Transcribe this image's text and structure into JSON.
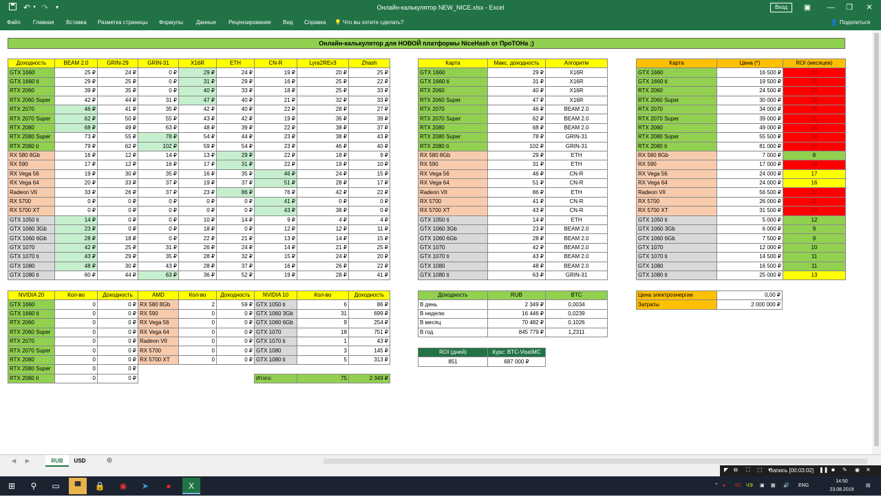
{
  "window": {
    "title": "Онлайн-калькулятор NEW_NICE.xlsx  -  Excel",
    "signin": "Вход"
  },
  "ribbon": {
    "tabs": [
      "Файл",
      "Главная",
      "Вставка",
      "Разметка страницы",
      "Формулы",
      "Данные",
      "Рецензирование",
      "Вид",
      "Справка"
    ],
    "tell_me": "Что вы хотите сделать?",
    "share": "Поделиться"
  },
  "banner": "Онлайн-калькулятор для НОВОЙ платформы NiceHash от ПроТОНа ;)",
  "t1": {
    "headers": [
      "Доходность",
      "BEAM 2.0",
      "GRIN-29",
      "GRIN-31",
      "X16R",
      "ETH",
      "CN-R",
      "Lyra2REv3",
      "Zhash"
    ],
    "rows": [
      [
        "GTX 1660",
        "25 ₽",
        "24 ₽",
        "0 ₽",
        "29 ₽",
        "24 ₽",
        "19 ₽",
        "20 ₽",
        "25 ₽"
      ],
      [
        "GTX 1660 ti",
        "29 ₽",
        "25 ₽",
        "0 ₽",
        "31 ₽",
        "29 ₽",
        "16 ₽",
        "25 ₽",
        "22 ₽"
      ],
      [
        "RTX 2060",
        "39 ₽",
        "35 ₽",
        "0 ₽",
        "40 ₽",
        "33 ₽",
        "18 ₽",
        "25 ₽",
        "33 ₽"
      ],
      [
        "RTX 2060 Super",
        "42 ₽",
        "44 ₽",
        "31 ₽",
        "47 ₽",
        "40 ₽",
        "21 ₽",
        "32 ₽",
        "33 ₽"
      ],
      [
        "RTX 2070",
        "46 ₽",
        "41 ₽",
        "35 ₽",
        "42 ₽",
        "40 ₽",
        "22 ₽",
        "28 ₽",
        "27 ₽"
      ],
      [
        "RTX 2070 Super",
        "62 ₽",
        "50 ₽",
        "55 ₽",
        "43 ₽",
        "42 ₽",
        "19 ₽",
        "36 ₽",
        "39 ₽"
      ],
      [
        "RTX 2080",
        "68 ₽",
        "49 ₽",
        "63 ₽",
        "48 ₽",
        "39 ₽",
        "22 ₽",
        "38 ₽",
        "37 ₽"
      ],
      [
        "RTX 2080 Super",
        "73 ₽",
        "55 ₽",
        "78 ₽",
        "54 ₽",
        "44 ₽",
        "23 ₽",
        "38 ₽",
        "43 ₽"
      ],
      [
        "RTX 2080 ti",
        "79 ₽",
        "62 ₽",
        "102 ₽",
        "59 ₽",
        "54 ₽",
        "23 ₽",
        "46 ₽",
        "40 ₽"
      ],
      [
        "RX 580 8Gb",
        "16 ₽",
        "12 ₽",
        "14 ₽",
        "13 ₽",
        "29 ₽",
        "22 ₽",
        "18 ₽",
        "9 ₽"
      ],
      [
        "RX 590",
        "17 ₽",
        "12 ₽",
        "16 ₽",
        "17 ₽",
        "31 ₽",
        "22 ₽",
        "19 ₽",
        "10 ₽"
      ],
      [
        "RX Vega 56",
        "19 ₽",
        "30 ₽",
        "35 ₽",
        "16 ₽",
        "35 ₽",
        "46 ₽",
        "24 ₽",
        "15 ₽"
      ],
      [
        "RX Vega 64",
        "20 ₽",
        "33 ₽",
        "37 ₽",
        "19 ₽",
        "37 ₽",
        "51 ₽",
        "28 ₽",
        "17 ₽"
      ],
      [
        "Radeon VII",
        "33 ₽",
        "26 ₽",
        "37 ₽",
        "23 ₽",
        "86 ₽",
        "76 ₽",
        "42 ₽",
        "22 ₽"
      ],
      [
        "RX 5700",
        "0 ₽",
        "0 ₽",
        "0 ₽",
        "0 ₽",
        "0 ₽",
        "41 ₽",
        "0 ₽",
        "0 ₽"
      ],
      [
        "RX 5700 XT",
        "0 ₽",
        "0 ₽",
        "0 ₽",
        "0 ₽",
        "0 ₽",
        "43 ₽",
        "38 ₽",
        "0 ₽"
      ],
      [
        "GTX 1050 ti",
        "14 ₽",
        "0 ₽",
        "0 ₽",
        "10 ₽",
        "14 ₽",
        "9 ₽",
        "4 ₽",
        "4 ₽"
      ],
      [
        "GTX 1060 3Gb",
        "23 ₽",
        "0 ₽",
        "0 ₽",
        "18 ₽",
        "0 ₽",
        "12 ₽",
        "12 ₽",
        "11 ₽"
      ],
      [
        "GTX 1060 6Gb",
        "28 ₽",
        "18 ₽",
        "0 ₽",
        "22 ₽",
        "21 ₽",
        "13 ₽",
        "14 ₽",
        "15 ₽"
      ],
      [
        "GTX 1070",
        "42 ₽",
        "25 ₽",
        "31 ₽",
        "26 ₽",
        "24 ₽",
        "14 ₽",
        "21 ₽",
        "25 ₽"
      ],
      [
        "GTX 1070 ti",
        "43 ₽",
        "29 ₽",
        "35 ₽",
        "28 ₽",
        "32 ₽",
        "15 ₽",
        "24 ₽",
        "20 ₽"
      ],
      [
        "GTX 1080",
        "48 ₽",
        "30 ₽",
        "43 ₽",
        "28 ₽",
        "37 ₽",
        "16 ₽",
        "26 ₽",
        "22 ₽"
      ],
      [
        "GTX 1080 ti",
        "60 ₽",
        "44 ₽",
        "63 ₽",
        "36 ₽",
        "52 ₽",
        "19 ₽",
        "28 ₽",
        "41 ₽"
      ]
    ]
  },
  "t2": {
    "headers": [
      "Карта",
      "Макс. доходность",
      "Алгоритм"
    ],
    "rows": [
      [
        "GTX 1660",
        "29 ₽",
        "X16R"
      ],
      [
        "GTX 1660 ti",
        "31 ₽",
        "X16R"
      ],
      [
        "RTX 2060",
        "40 ₽",
        "X16R"
      ],
      [
        "RTX 2060 Super",
        "47 ₽",
        "X16R"
      ],
      [
        "RTX 2070",
        "46 ₽",
        "BEAM 2.0"
      ],
      [
        "RTX 2070 Super",
        "62 ₽",
        "BEAM 2.0"
      ],
      [
        "RTX 2080",
        "68 ₽",
        "BEAM 2.0"
      ],
      [
        "RTX 2080 Super",
        "78 ₽",
        "GRIN-31"
      ],
      [
        "RTX 2080 ti",
        "102 ₽",
        "GRIN-31"
      ],
      [
        "RX 580 8Gb",
        "29 ₽",
        "ETH"
      ],
      [
        "RX 590",
        "31 ₽",
        "ETH"
      ],
      [
        "RX Vega 56",
        "46 ₽",
        "CN-R"
      ],
      [
        "RX Vega 64",
        "51 ₽",
        "CN-R"
      ],
      [
        "Radeon VII",
        "86 ₽",
        "ETH"
      ],
      [
        "RX 5700",
        "41 ₽",
        "CN-R"
      ],
      [
        "RX 5700 XT",
        "43 ₽",
        "CN-R"
      ],
      [
        "GTX 1050 ti",
        "14 ₽",
        "ETH"
      ],
      [
        "GTX 1060 3Gb",
        "23 ₽",
        "BEAM 2.0"
      ],
      [
        "GTX 1060 6Gb",
        "28 ₽",
        "BEAM 2.0"
      ],
      [
        "GTX 1070",
        "42 ₽",
        "BEAM 2.0"
      ],
      [
        "GTX 1070 ti",
        "43 ₽",
        "BEAM 2.0"
      ],
      [
        "GTX 1080",
        "48 ₽",
        "BEAM 2.0"
      ],
      [
        "GTX 1080 ti",
        "63 ₽",
        "GRIN-31"
      ]
    ]
  },
  "t3": {
    "headers": [
      "Карта",
      "Цена (*)",
      "ROI (месяцев)"
    ],
    "rows": [
      [
        "GTX 1660",
        "16 500 ₽",
        "19"
      ],
      [
        "GTX 1660 ti",
        "19 500 ₽",
        "21"
      ],
      [
        "RTX 2060",
        "24 500 ₽",
        "20"
      ],
      [
        "RTX 2060 Super",
        "30 000 ₽",
        "21"
      ],
      [
        "RTX 2070",
        "34 000 ₽",
        "25"
      ],
      [
        "RTX 2070 Super",
        "39 000 ₽",
        "21"
      ],
      [
        "RTX 2080",
        "49 000 ₽",
        "24"
      ],
      [
        "RTX 2080 Super",
        "55 500 ₽",
        "24"
      ],
      [
        "RTX 2080 ti",
        "81 000 ₽",
        "27"
      ],
      [
        "RX 580 8Gb",
        "7 000 ₽",
        "8"
      ],
      [
        "RX 590",
        "17 000 ₽",
        "18"
      ],
      [
        "RX Vega 56",
        "24 000 ₽",
        "17"
      ],
      [
        "RX Vega 64",
        "24 000 ₽",
        "16"
      ],
      [
        "Radeon VII",
        "56 500 ₽",
        "22"
      ],
      [
        "RX 5700",
        "26 000 ₽",
        "21"
      ],
      [
        "RX 5700 XT",
        "31 500 ₽",
        "24"
      ],
      [
        "GTX 1050 ti",
        "5 000 ₽",
        "12"
      ],
      [
        "GTX 1060 3Gb",
        "6 000 ₽",
        "9"
      ],
      [
        "GTX 1060 6Gb",
        "7 500 ₽",
        "9"
      ],
      [
        "GTX 1070",
        "12 000 ₽",
        "10"
      ],
      [
        "GTX 1070 ti",
        "14 500 ₽",
        "11"
      ],
      [
        "GTX 1080",
        "16 500 ₽",
        "11"
      ],
      [
        "GTX 1080 ti",
        "25 000 ₽",
        "13"
      ]
    ]
  },
  "t4": {
    "headers": [
      "NVIDIA 20",
      "Кол-во",
      "Доходность",
      "AMD",
      "Кол-во",
      "Доходность",
      "NVIDIA 10",
      "Кол-во",
      "Доходность"
    ],
    "rows": [
      [
        "GTX 1660",
        "0",
        "0 ₽",
        "RX 580 8Gb",
        "2",
        "59 ₽",
        "GTX 1050 ti",
        "6",
        "86 ₽"
      ],
      [
        "GTX 1660 ti",
        "0",
        "0 ₽",
        "RX 590",
        "0",
        "0 ₽",
        "GTX 1060 3Gb",
        "31",
        "699 ₽"
      ],
      [
        "RTX 2060",
        "0",
        "0 ₽",
        "RX Vega 56",
        "0",
        "0 ₽",
        "GTX 1060 6Gb",
        "9",
        "254 ₽"
      ],
      [
        "RTX 2060 Super",
        "0",
        "0 ₽",
        "RX Vega 64",
        "0",
        "0 ₽",
        "GTX 1070",
        "18",
        "751 ₽"
      ],
      [
        "RTX 2070",
        "0",
        "0 ₽",
        "Radeon VII",
        "0",
        "0 ₽",
        "GTX 1070 ti",
        "1",
        "43 ₽"
      ],
      [
        "RTX 2070 Super",
        "0",
        "0 ₽",
        "RX 5700",
        "0",
        "0 ₽",
        "GTX 1080",
        "3",
        "145 ₽"
      ],
      [
        "RTX 2080",
        "0",
        "0 ₽",
        "RX 5700 XT",
        "0",
        "0 ₽",
        "GTX 1080 ti",
        "5",
        "313 ₽"
      ],
      [
        "RTX 2080 Super",
        "0",
        "0 ₽"
      ],
      [
        "RTX 2080 ti",
        "0",
        "0 ₽"
      ]
    ],
    "total": {
      "label": "Итого:",
      "count": "75",
      "sum": "2 349 ₽"
    }
  },
  "t5": {
    "headers": [
      "Доходность",
      "RUB",
      "BTC"
    ],
    "rows": [
      [
        "В день",
        "2 349 ₽",
        "0,0034"
      ],
      [
        "В неделю",
        "16 446 ₽",
        "0,0239"
      ],
      [
        "В месяц",
        "70 482 ₽",
        "0,1026"
      ],
      [
        "В год",
        "845 779 ₽",
        "1,2311"
      ]
    ]
  },
  "t6": {
    "headers": [
      "ROI (дней)",
      "Курс: BTC-Visa\\MC"
    ],
    "values": [
      "851",
      "687 000 ₽"
    ]
  },
  "t7": {
    "rows": [
      [
        "Цена электроэнергии",
        "0,00 ₽"
      ],
      [
        "Затраты",
        "2 000 000 ₽"
      ]
    ]
  },
  "sheets": [
    "RUB",
    "USD"
  ],
  "tray": {
    "rec": "Запись [00:03:02]",
    "lang": "ENG",
    "time": "14:50",
    "date": "23.08.2019",
    "fps": "63",
    "fps2": "ЧЭ"
  },
  "colors": {
    "excel_green": "#217346",
    "header_yellow": "#ffff00",
    "header_orange": "#ffc000",
    "nvidia_green": "#92d050",
    "amd_peach": "#f8cbad",
    "legacy_grey": "#d9d9d9",
    "max_green": "#c6efce",
    "roi_red": "#ff0000"
  }
}
